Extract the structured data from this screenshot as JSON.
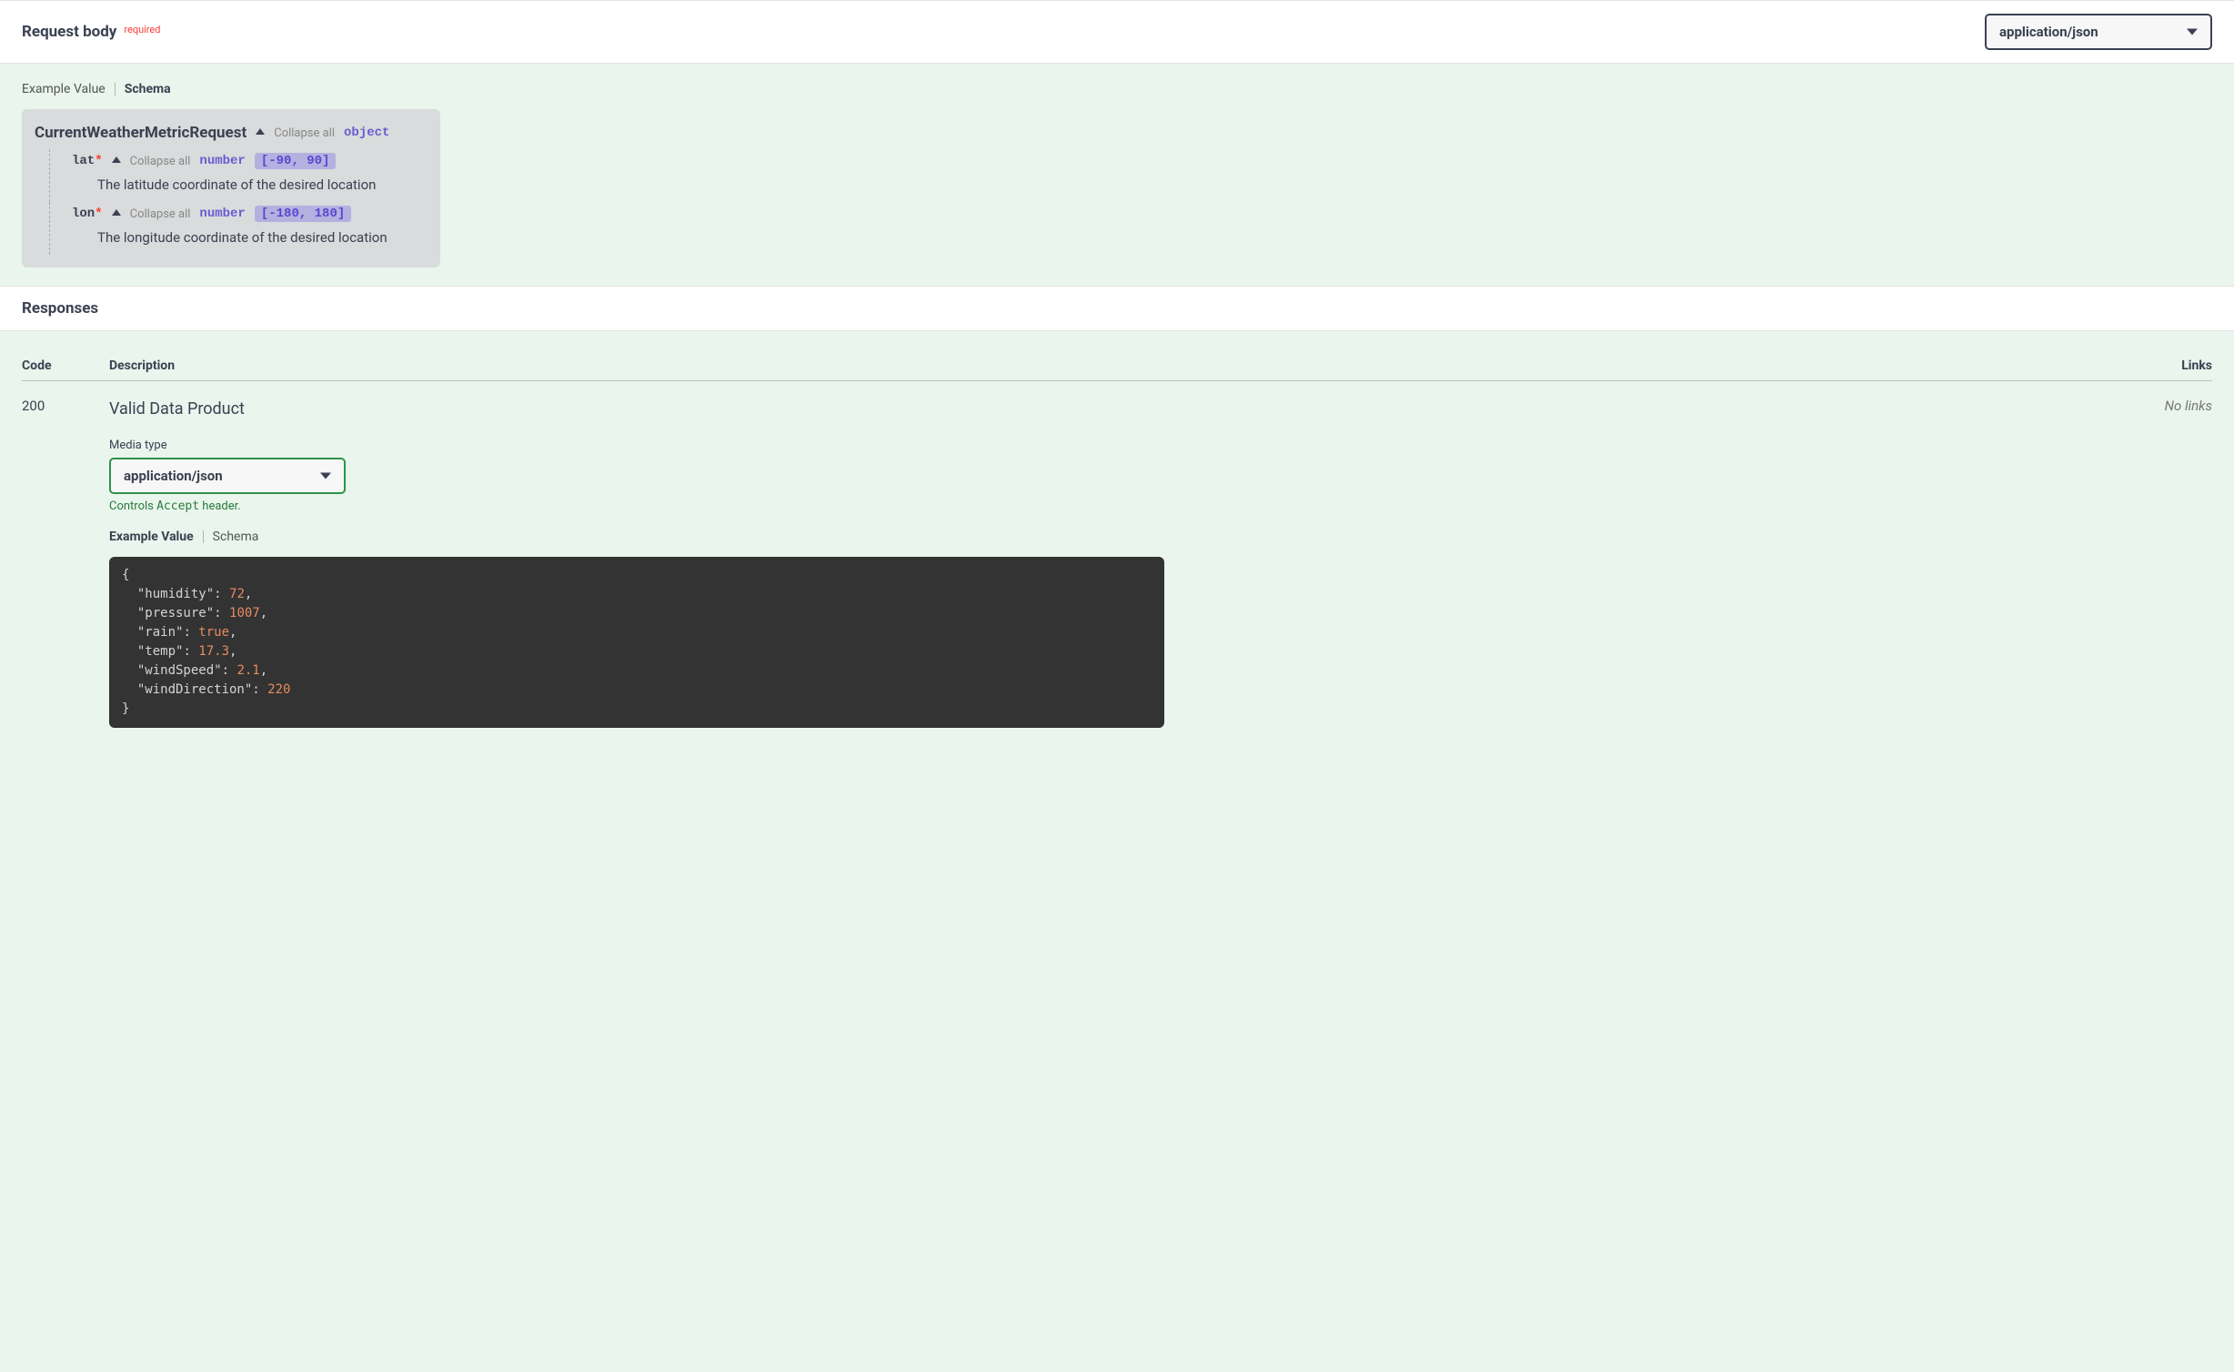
{
  "request_body": {
    "title": "Request body",
    "required_label": "required",
    "content_type": "application/json",
    "tabs": {
      "example_value": "Example Value",
      "schema": "Schema"
    },
    "schema": {
      "name": "CurrentWeatherMetricRequest",
      "collapse_all": "Collapse all",
      "type": "object",
      "properties": [
        {
          "key": "lat",
          "required": true,
          "collapse_all": "Collapse all",
          "type": "number",
          "range": "[-90, 90]",
          "description": "The latitude coordinate of the desired location"
        },
        {
          "key": "lon",
          "required": true,
          "collapse_all": "Collapse all",
          "type": "number",
          "range": "[-180, 180]",
          "description": "The longitude coordinate of the desired location"
        }
      ]
    }
  },
  "responses": {
    "title": "Responses",
    "columns": {
      "code": "Code",
      "description": "Description",
      "links": "Links"
    },
    "rows": [
      {
        "code": "200",
        "description": "Valid Data Product",
        "links": "No links",
        "media_type_label": "Media type",
        "media_type_value": "application/json",
        "accept_hint_prefix": "Controls ",
        "accept_hint_mono": "Accept",
        "accept_hint_suffix": " header.",
        "tabs": {
          "example_value": "Example Value",
          "schema": "Schema"
        },
        "example": {
          "humidity": 72,
          "pressure": 1007,
          "rain": true,
          "temp": 17.3,
          "windSpeed": 2.1,
          "windDirection": 220
        }
      }
    ]
  }
}
